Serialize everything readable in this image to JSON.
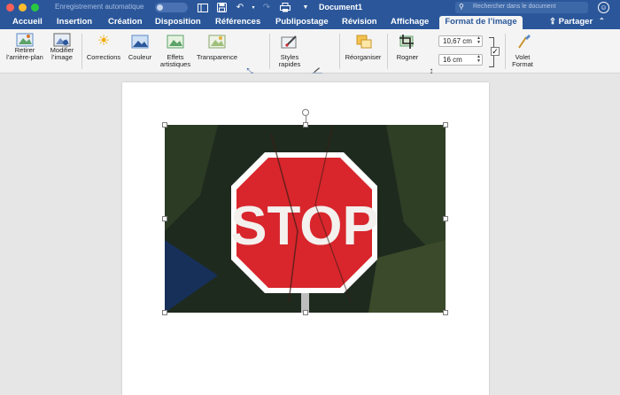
{
  "titlebar": {
    "autosave_label": "Enregistrement automatique",
    "document_title": "Document1",
    "search_placeholder": "Rechercher dans le document"
  },
  "tabs": [
    {
      "label": "Accueil"
    },
    {
      "label": "Insertion"
    },
    {
      "label": "Création"
    },
    {
      "label": "Disposition"
    },
    {
      "label": "Références"
    },
    {
      "label": "Publipostage"
    },
    {
      "label": "Révision"
    },
    {
      "label": "Affichage"
    },
    {
      "label": "Format de l’image",
      "active": true
    }
  ],
  "share_label": "Partager",
  "ribbon": {
    "remove_background": [
      "Retirer",
      "l’arrière-plan"
    ],
    "change_picture": [
      "Modifier",
      "l’image"
    ],
    "corrections": "Corrections",
    "color": "Couleur",
    "artistic_effects": [
      "Effets",
      "artistiques"
    ],
    "transparency": "Transparence",
    "quick_styles": [
      "Styles",
      "rapides"
    ],
    "arrange": "Réorganiser",
    "crop": "Rogner",
    "height_value": "10,67 cm",
    "width_value": "16 cm",
    "format_pane": [
      "Volet",
      "Format"
    ]
  },
  "image": {
    "sign_text": "STOP"
  },
  "colors": {
    "word_blue": "#2b579a",
    "ribbon_bg": "#f4f4f4",
    "stop_red": "#d8262c"
  }
}
